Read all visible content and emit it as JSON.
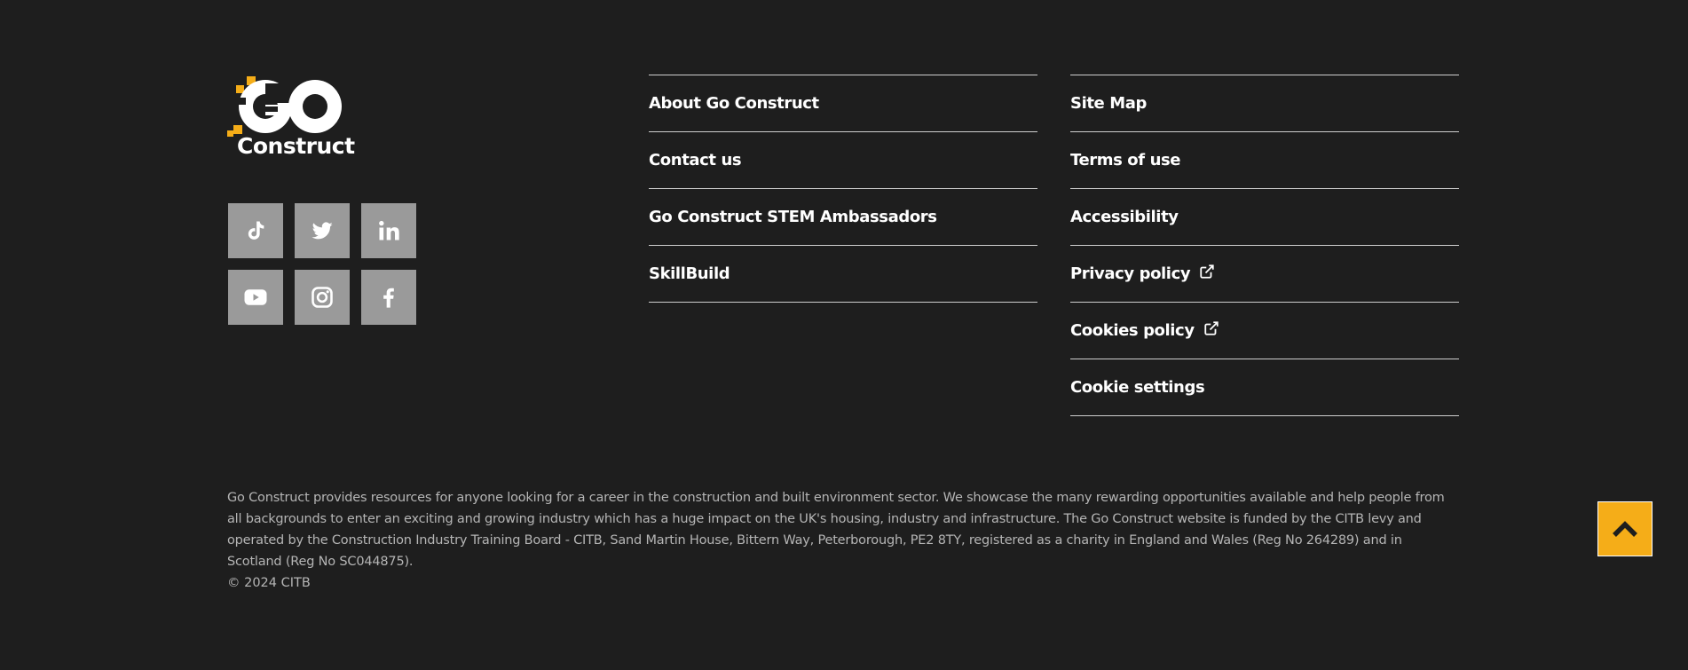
{
  "logo": {
    "word": "Construct",
    "accent_color": "#f5ad18"
  },
  "social": [
    {
      "icon": "tiktok-icon",
      "name": "social-tiktok-button"
    },
    {
      "icon": "twitter-icon",
      "name": "social-twitter-button"
    },
    {
      "icon": "linkedin-icon",
      "name": "social-linkedin-button"
    },
    {
      "icon": "youtube-icon",
      "name": "social-youtube-button"
    },
    {
      "icon": "instagram-icon",
      "name": "social-instagram-button"
    },
    {
      "icon": "facebook-icon",
      "name": "social-facebook-button"
    }
  ],
  "links_col1": [
    {
      "label": "About Go Construct"
    },
    {
      "label": "Contact us"
    },
    {
      "label": "Go Construct STEM Ambassadors"
    },
    {
      "label": "SkillBuild"
    }
  ],
  "links_col2": [
    {
      "label": "Site Map"
    },
    {
      "label": "Terms of use"
    },
    {
      "label": "Accessibility"
    },
    {
      "label": "Privacy policy",
      "external": true
    },
    {
      "label": "Cookies policy",
      "external": true
    },
    {
      "label": "Cookie settings"
    }
  ],
  "footer": {
    "description": "Go Construct provides resources for anyone looking for a career in the construction and built environment sector. We showcase the many rewarding opportunities available and help people from all backgrounds to enter an exciting and growing industry which has a huge impact on the UK's housing, industry and infrastructure. The Go Construct website is funded by the CITB levy and operated by the Construction Industry Training Board - CITB, Sand Martin House, Bittern Way, Peterborough, PE2 8TY, registered as a charity in England and Wales (Reg No 264289) and in Scotland (Reg No SC044875).",
    "copyright": "© 2024 CITB"
  },
  "back_to_top": {
    "icon": "chevron-up-icon"
  },
  "colors": {
    "background": "#1e1e1e",
    "accent": "#f5ad18",
    "social_tile": "#9a9a9a"
  }
}
